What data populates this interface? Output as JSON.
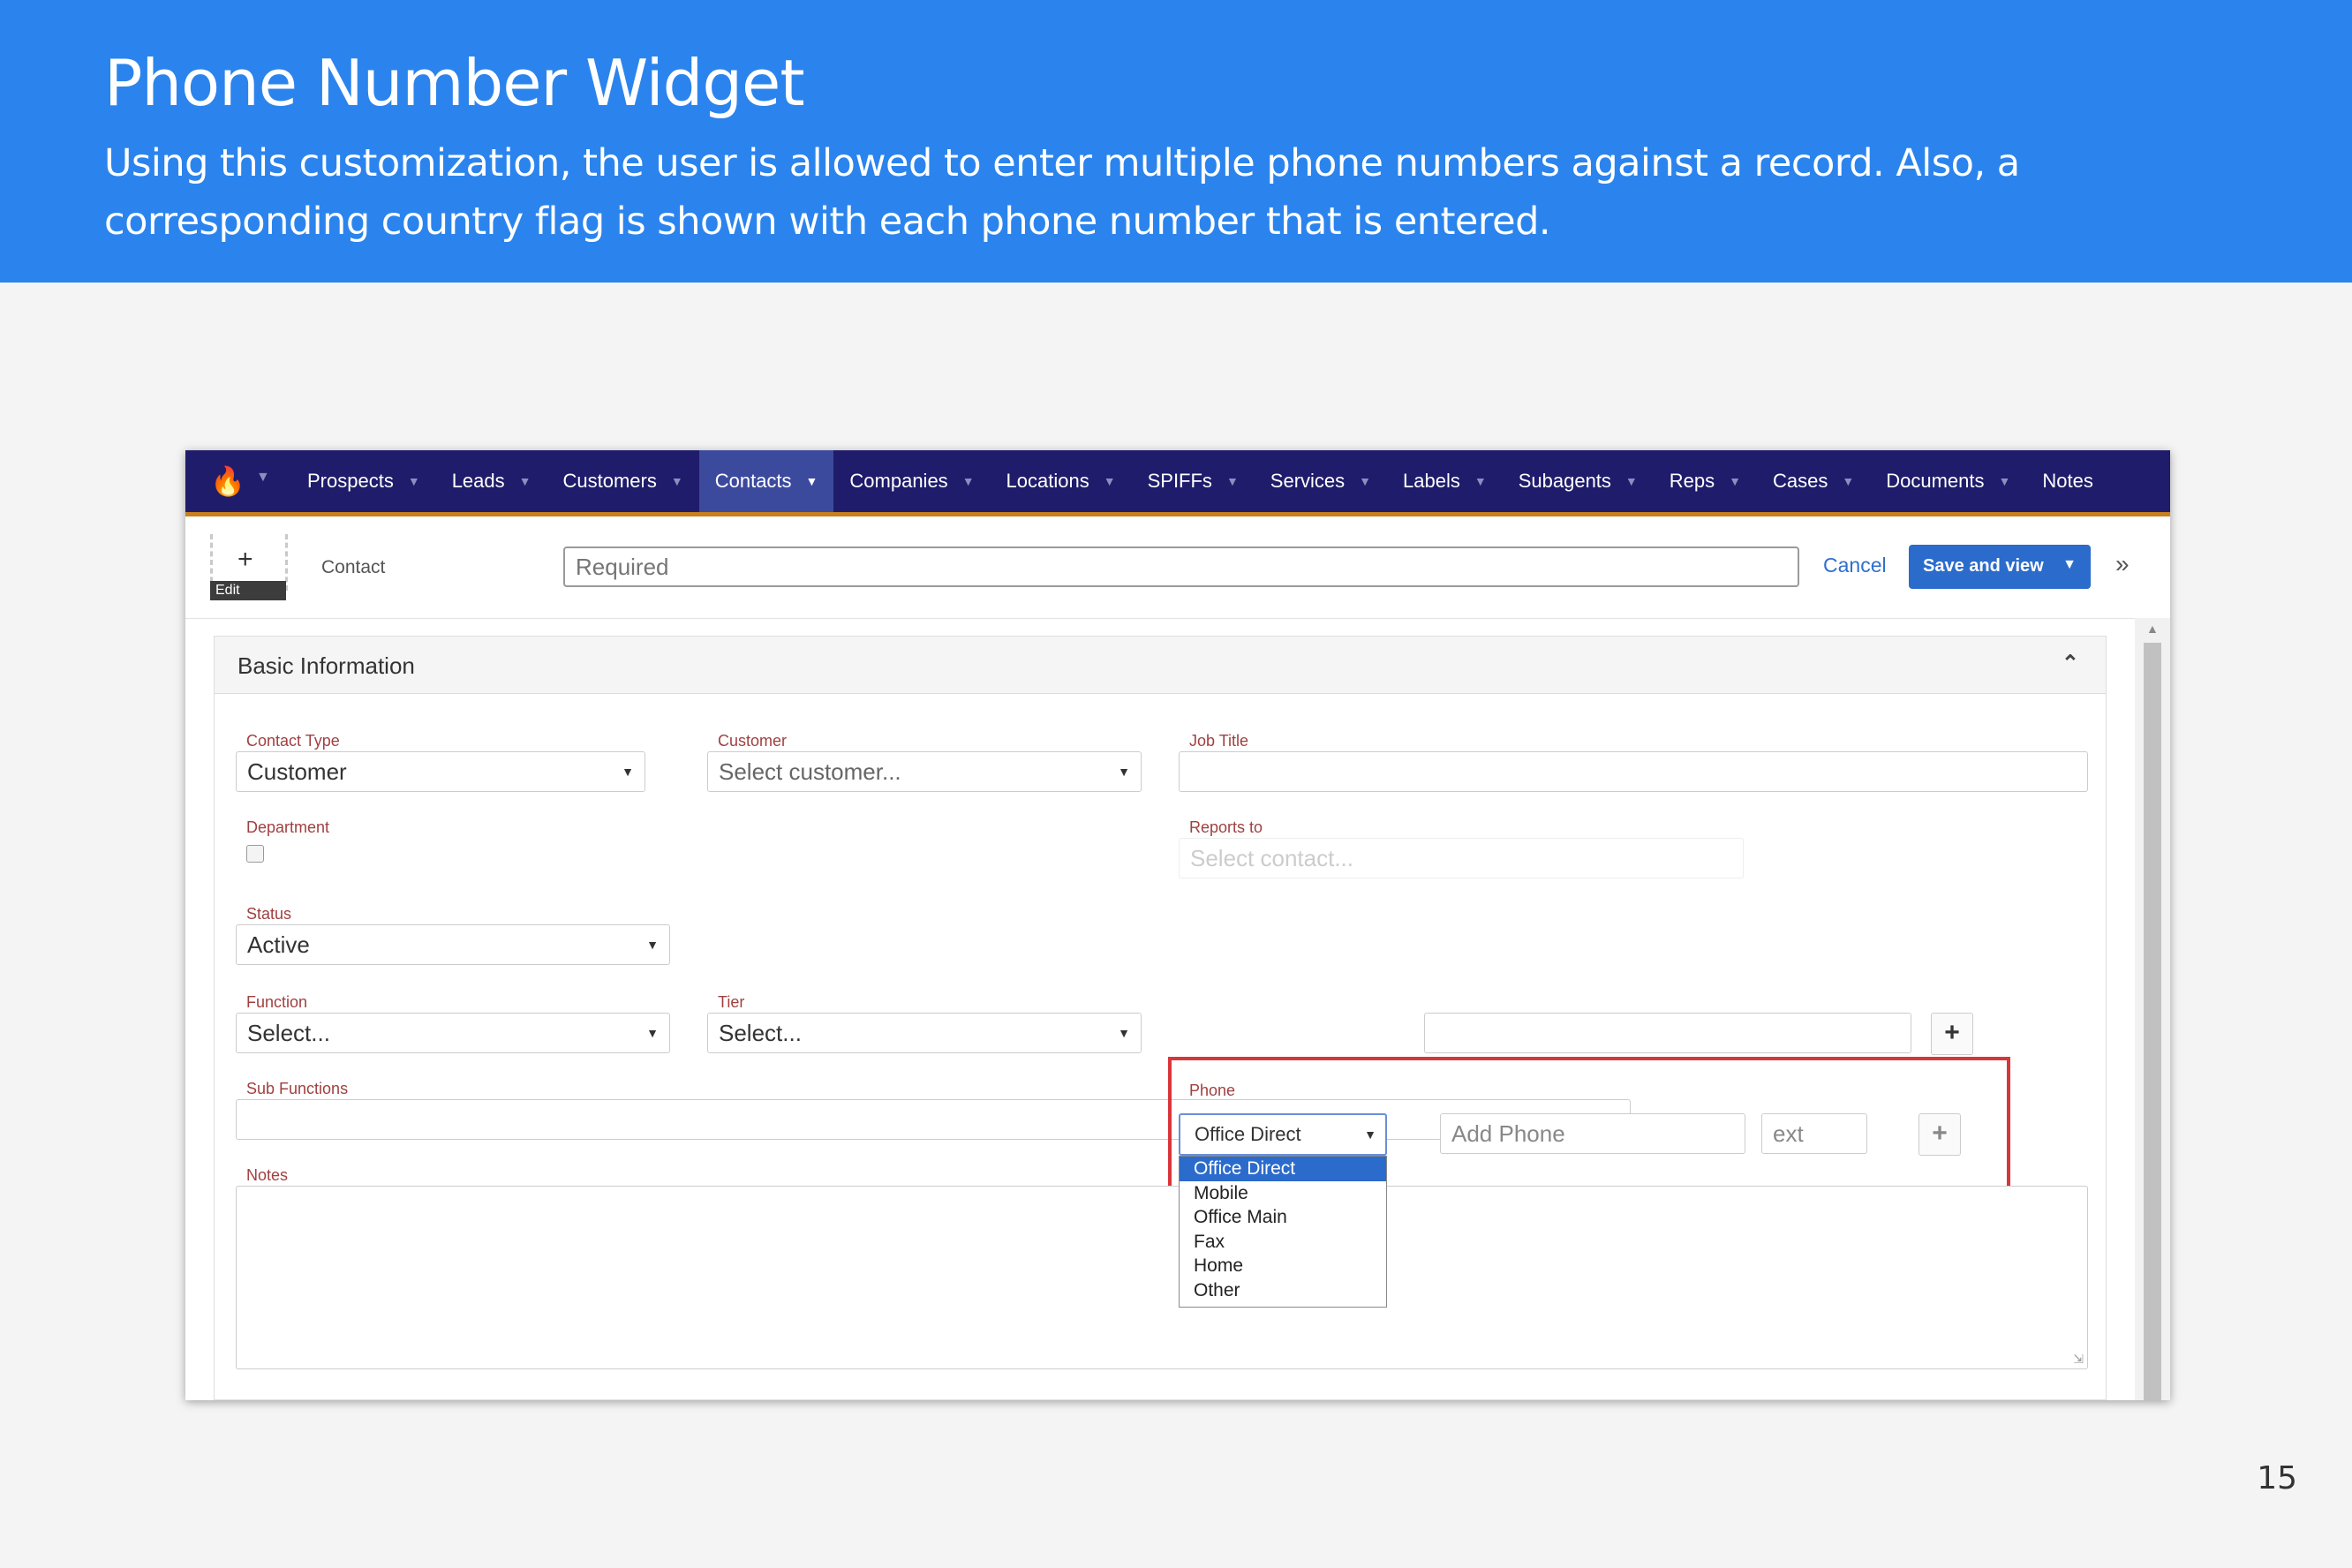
{
  "slide": {
    "title": "Phone Number Widget",
    "description": "Using this customization, the user is allowed to enter multiple phone numbers against a record. Also, a corresponding country flag is shown with each phone number that is entered.",
    "page_number": "15"
  },
  "navbar": {
    "items": [
      {
        "label": "Prospects",
        "active": false
      },
      {
        "label": "Leads",
        "active": false
      },
      {
        "label": "Customers",
        "active": false
      },
      {
        "label": "Contacts",
        "active": true
      },
      {
        "label": "Companies",
        "active": false
      },
      {
        "label": "Locations",
        "active": false
      },
      {
        "label": "SPIFFs",
        "active": false
      },
      {
        "label": "Services",
        "active": false
      },
      {
        "label": "Labels",
        "active": false
      },
      {
        "label": "Subagents",
        "active": false
      },
      {
        "label": "Reps",
        "active": false
      },
      {
        "label": "Cases",
        "active": false
      },
      {
        "label": "Documents",
        "active": false
      },
      {
        "label": "Notes",
        "active": false
      }
    ],
    "colors": {
      "background": "#1f1c6b",
      "active": "#3c4a9e",
      "underline": "#c8801e"
    }
  },
  "toolbar": {
    "edit_label": "Edit",
    "record_type": "Contact",
    "name_placeholder": "Required",
    "cancel_label": "Cancel",
    "save_label": "Save and view"
  },
  "panel": {
    "title": "Basic Information"
  },
  "form": {
    "contact_type": {
      "label": "Contact Type",
      "value": "Customer"
    },
    "customer": {
      "label": "Customer",
      "value": "Select customer..."
    },
    "job_title": {
      "label": "Job Title",
      "value": ""
    },
    "department": {
      "label": "Department",
      "checked": false
    },
    "reports_to": {
      "label": "Reports to",
      "placeholder": "Select contact..."
    },
    "status": {
      "label": "Status",
      "value": "Active"
    },
    "phone": {
      "label": "Phone",
      "type_value": "Office Direct",
      "number_placeholder": "Add Phone",
      "ext_placeholder": "ext",
      "type_options": [
        "Office Direct",
        "Mobile",
        "Office Main",
        "Fax",
        "Home",
        "Other"
      ],
      "selected_option": "Office Direct"
    },
    "function": {
      "label": "Function",
      "value": "Select..."
    },
    "tier": {
      "label": "Tier",
      "value": "Select..."
    },
    "sub_functions": {
      "label": "Sub Functions",
      "value": ""
    },
    "notes": {
      "label": "Notes",
      "value": ""
    }
  },
  "colors": {
    "header_blue": "#2b84ed",
    "highlight_red": "#d9363a",
    "primary_button": "#2b6bcb"
  }
}
